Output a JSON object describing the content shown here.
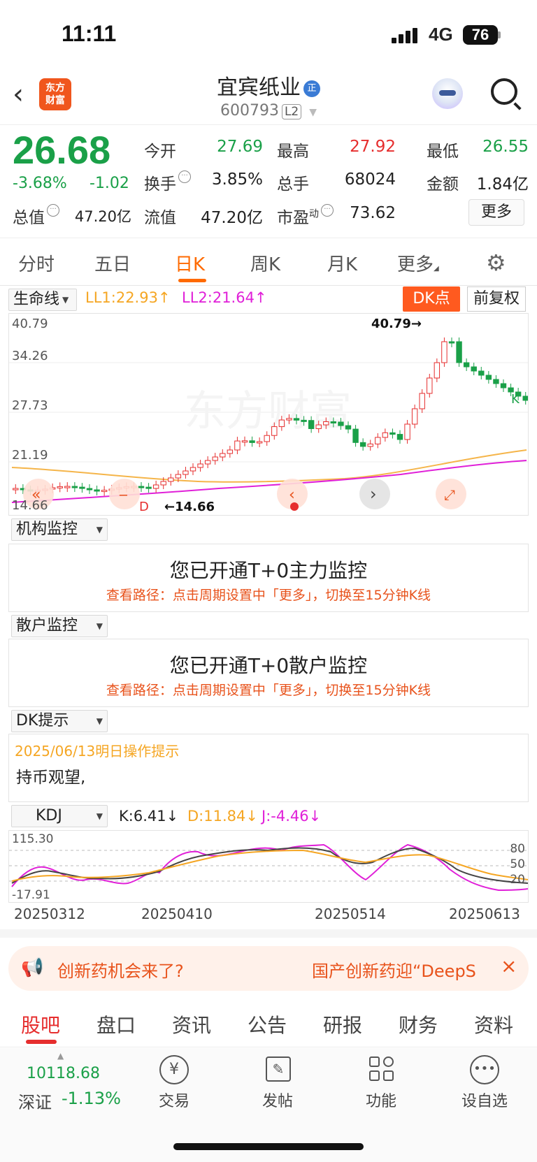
{
  "status": {
    "time": "11:11",
    "network": "4G",
    "battery": "76"
  },
  "header": {
    "back_icon": "chevron-left-icon",
    "logo_text": [
      "东方",
      "财富"
    ],
    "stock_name": "宜宾纸业",
    "badge": "正",
    "stock_code": "600793",
    "level": "L2"
  },
  "quote": {
    "price": "26.68",
    "change_pct": "-3.68%",
    "change": "-1.02",
    "fields": {
      "open_label": "今开",
      "open": "27.69",
      "high_label": "最高",
      "high": "27.92",
      "low_label": "最低",
      "low": "26.55",
      "turnover_label": "换手",
      "turnover": "3.85%",
      "volume_label": "总手",
      "volume": "68024",
      "amount_label": "金额",
      "amount": "1.84亿",
      "mcap_label": "总值",
      "mcap": "47.20亿",
      "float_label": "流值",
      "float": "47.20亿",
      "pe_label": "市盈",
      "pe_sup": "动",
      "pe": "73.62"
    },
    "more": "更多"
  },
  "period_tabs": [
    "分时",
    "五日",
    "日K",
    "周K",
    "月K",
    "更多"
  ],
  "active_tab": "日K",
  "chart_controls": {
    "indicator": "生命线",
    "ll1": "LL1:22.93↑",
    "ll2": "LL2:21.64↑",
    "dk_button": "DK点",
    "adjust_button": "前复权"
  },
  "kline": {
    "y_ticks": [
      "40.79",
      "34.26",
      "27.73",
      "21.19",
      "14.66"
    ],
    "high_annotation": "40.79→",
    "low_annotation": "←14.66",
    "k_marker": "K",
    "d_marker": "D"
  },
  "inst_monitor": {
    "dropdown": "机构监控",
    "title": "您已开通T+0主力监控",
    "hint": "查看路径：点击周期设置中「更多」，切换至15分钟K线"
  },
  "retail_monitor": {
    "dropdown": "散户监控",
    "title": "您已开通T+0散户监控",
    "hint": "查看路径：点击周期设置中「更多」，切换至15分钟K线"
  },
  "dk_tip": {
    "dropdown": "DK提示",
    "date_line": "2025/06/13明日操作提示",
    "advice": "持币观望,"
  },
  "kdj": {
    "dropdown": "KDJ",
    "k": "K:6.41↓",
    "d": "D:11.84↓",
    "j": "J:-4.46↓",
    "y_top": "115.30",
    "y_bottom": "-17.91",
    "levels": [
      "80",
      "50",
      "20"
    ],
    "dates": [
      "20250312",
      "20250410",
      "20250514",
      "20250613"
    ]
  },
  "ad": {
    "text_left": "创新药机会来了?",
    "text_right": "国产创新药迎“DeepS",
    "close": "×"
  },
  "bottom_tabs": [
    "股吧",
    "盘口",
    "资讯",
    "公告",
    "研报",
    "财务",
    "资料"
  ],
  "bottom_nav": {
    "index_value": "10118.68",
    "index_name": "深证",
    "index_change": "-1.13%",
    "items": [
      "交易",
      "发帖",
      "功能",
      "设自选"
    ]
  },
  "colors": {
    "up": "#e62e2e",
    "down": "#1aa048",
    "accent": "#ff6a00"
  }
}
